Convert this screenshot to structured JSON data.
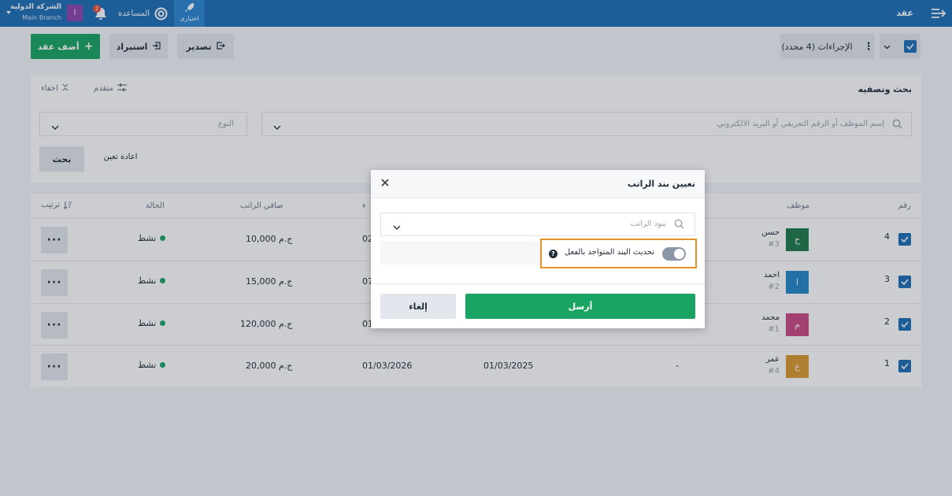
{
  "topbar": {
    "page_title": "عقد",
    "quick_label": "اختيارى",
    "help_label": "المساعدة",
    "notifications_count": "2",
    "user_initial": "ا",
    "company_name": "الشركة الدولية",
    "branch_name": "Main Branch",
    "colors": {
      "bar": "#1f6fb5",
      "quick": "#2b87d1",
      "avatar": "#8e44ad",
      "badge": "#e74c3c"
    }
  },
  "toolbar": {
    "add_label": "أضف عقد",
    "import_label": "استيراد",
    "export_label": "تصدير",
    "actions_label": "الإجراءات (4 محدد)"
  },
  "filters": {
    "title": "بحث وتصفيه",
    "advanced_label": "متقدم",
    "hide_label": "اخفاء",
    "search_placeholder": "إسم الموظف أو الرقم التعريفي أو البريد الالكتروني",
    "type_placeholder": "النوع",
    "reset_label": "اعادة تعين",
    "search_button": "بحث"
  },
  "table": {
    "headers": {
      "number": "رقم",
      "employee": "موظف",
      "start_partial": "ء",
      "net_salary": "صافي الراتب",
      "status": "الحالة",
      "sort": "ترتيب"
    },
    "rows": [
      {
        "number": "4",
        "name": "حسن",
        "code": "#3",
        "initial": "ح",
        "color": "#1e7a4a",
        "col3": "",
        "col4": "",
        "start": "02",
        "salary": "10,000 ج.م",
        "status": "نشط"
      },
      {
        "number": "3",
        "name": "احمد",
        "code": "#2",
        "initial": "ا",
        "color": "#2487c8",
        "col3": "",
        "col4": "",
        "start": "07",
        "salary": "15,000 ج.م",
        "status": "نشط"
      },
      {
        "number": "2",
        "name": "محمد",
        "code": "#1",
        "initial": "م",
        "color": "#cc4a84",
        "col3": "",
        "col4": "",
        "start": "01",
        "salary": "120,000 ج.م",
        "status": "نشط"
      },
      {
        "number": "1",
        "name": "عمر",
        "code": "#4",
        "initial": "ع",
        "color": "#d99a2b",
        "col3": "-",
        "col4": "01/03/2025",
        "start": "01/03/2026",
        "salary": "20,000 ج.م",
        "status": "نشط"
      }
    ]
  },
  "modal": {
    "title": "تعيين بند الراتب",
    "select_placeholder": "بنود الراتب",
    "toggle_label": "تحديث البند المتواجد بالفعل",
    "submit_label": "أرسل",
    "cancel_label": "إلغاء",
    "colors": {
      "submit": "#19a463",
      "highlight": "#e8902a",
      "toggle": "#8a96a6"
    }
  }
}
